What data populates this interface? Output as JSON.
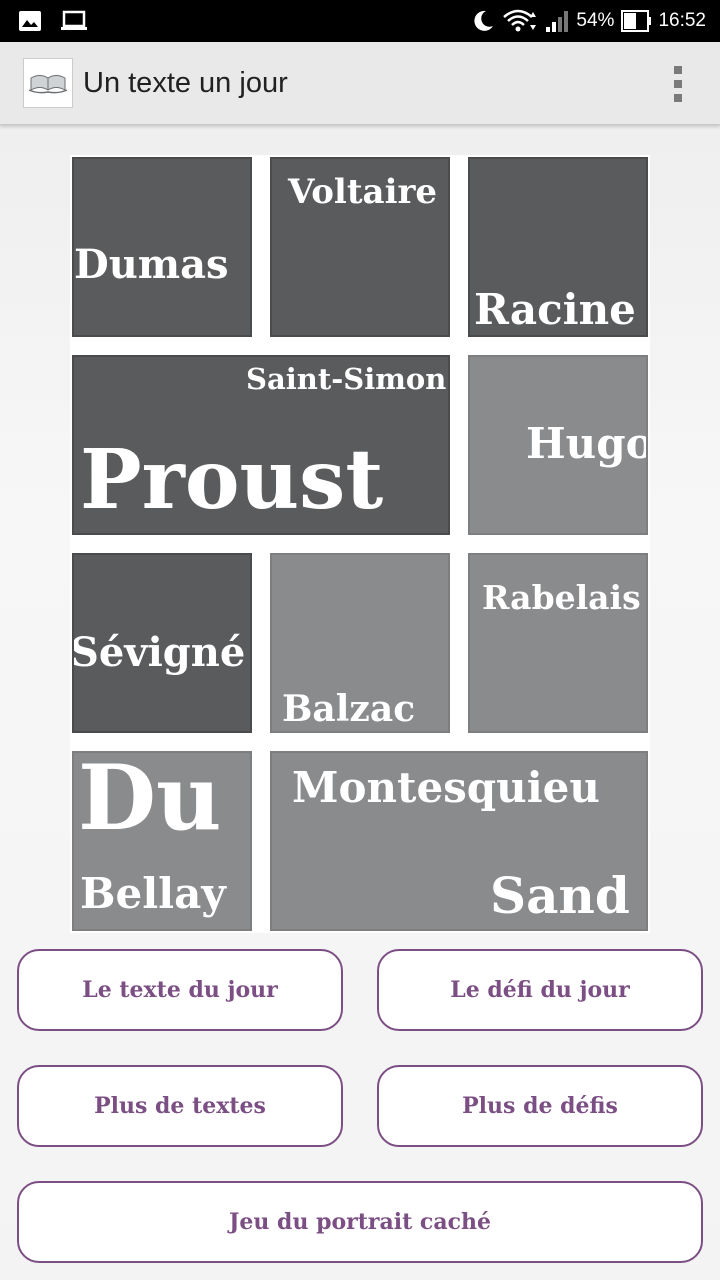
{
  "status": {
    "battery": "54%",
    "time": "16:52"
  },
  "appbar": {
    "title": "Un texte un jour"
  },
  "mosaic": {
    "dumas": "Dumas",
    "voltaire": "Voltaire",
    "racine": "Racine",
    "saint_simon": "Saint-Simon",
    "proust": "Proust",
    "hugo": "Hugo",
    "sevigne": "Sévigné",
    "balzac": "Balzac",
    "rabelais": "Rabelais",
    "du": "Du",
    "bellay": "Bellay",
    "montesquieu": "Montesquieu",
    "sand": "Sand"
  },
  "buttons": {
    "texte_du_jour": "Le texte du jour",
    "defi_du_jour": "Le défi du jour",
    "plus_textes": "Plus de textes",
    "plus_defis": "Plus de défis",
    "portrait": "Jeu du portrait caché"
  },
  "colors": {
    "accent": "#7b4f84",
    "tile_dark": "#5a5b5d",
    "tile_light": "#8a8b8d"
  }
}
